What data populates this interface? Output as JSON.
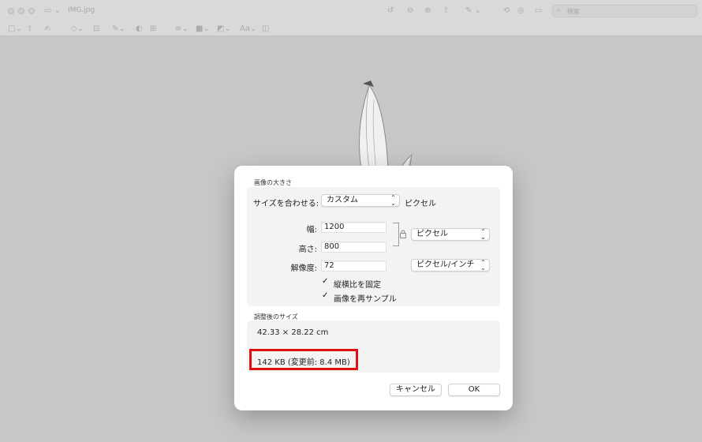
{
  "window": {
    "title": "IMG.jpg",
    "search_placeholder": "検索"
  },
  "dialog": {
    "image_size_section": "画像の大きさ",
    "fit_label": "サイズを合わせる:",
    "fit_value": "カスタム",
    "fit_unit": "ピクセル",
    "width_label": "幅:",
    "width_value": "1200",
    "height_label": "高さ:",
    "height_value": "800",
    "size_unit": "ピクセル",
    "resolution_label": "解像度:",
    "resolution_value": "72",
    "resolution_unit": "ピクセル/インチ",
    "scale_proportionally": "縦横比を固定",
    "resample_image": "画像を再サンプル",
    "resulting_size_section": "調整後のサイズ",
    "dimensions_text": "42.33 × 28.22 cm",
    "file_size_text": "142 KB (変更前: 8.4 MB)",
    "cancel_label": "キャンセル",
    "ok_label": "OK"
  }
}
